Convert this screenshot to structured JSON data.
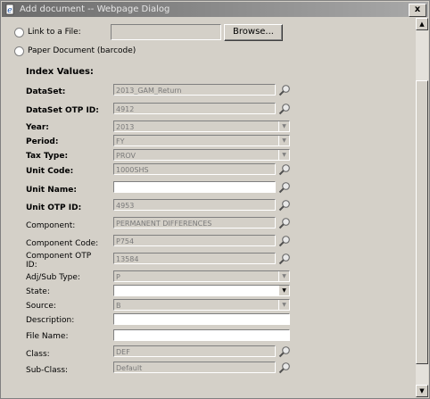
{
  "window": {
    "title": "Add document -- Webpage Dialog",
    "close_label": "x"
  },
  "source": {
    "link_label": "Link to a File:",
    "browse_label": "Browse...",
    "paper_label": "Paper Document (barcode)"
  },
  "index": {
    "title": "Index Values:",
    "dataset": {
      "label": "DataSet:",
      "value": "2013_GAM_Return"
    },
    "dataset_otp": {
      "label": "DataSet OTP ID:",
      "value": "4912"
    },
    "year": {
      "label": "Year:",
      "value": "2013"
    },
    "period": {
      "label": "Period:",
      "value": "FY"
    },
    "tax_type": {
      "label": "Tax Type:",
      "value": "PROV"
    },
    "unit_code": {
      "label": "Unit Code:",
      "value": "1000SHS"
    },
    "unit_name": {
      "label": "Unit Name:",
      "value": ""
    },
    "unit_otp": {
      "label": "Unit OTP ID:",
      "value": "4953"
    },
    "component": {
      "label": "Component:",
      "value": "PERMANENT DIFFERENCES"
    },
    "component_code": {
      "label": "Component Code:",
      "value": "P754"
    },
    "component_otp": {
      "label_line1": "Component OTP",
      "label_line2": "ID:",
      "value": "13584"
    },
    "adj_type": {
      "label": "Adj/Sub Type:",
      "value": "P"
    },
    "state": {
      "label": "State:",
      "value": ""
    },
    "source_field": {
      "label": "Source:",
      "value": "B"
    },
    "description": {
      "label": "Description:",
      "value": ""
    },
    "file_name": {
      "label": "File Name:",
      "value": ""
    },
    "class": {
      "label": "Class:",
      "value": "DEF"
    },
    "sub_class": {
      "label": "Sub-Class:",
      "value": "Default"
    }
  },
  "icons": {
    "title": "ie-page-icon",
    "lookup": "magnifier-icon",
    "dropdown": "dropdown-arrow-icon"
  },
  "colors": {
    "titlebar_start": "#6b6b6b",
    "titlebar_end": "#a9a9a9",
    "dialog_bg": "#d4d0c8"
  }
}
